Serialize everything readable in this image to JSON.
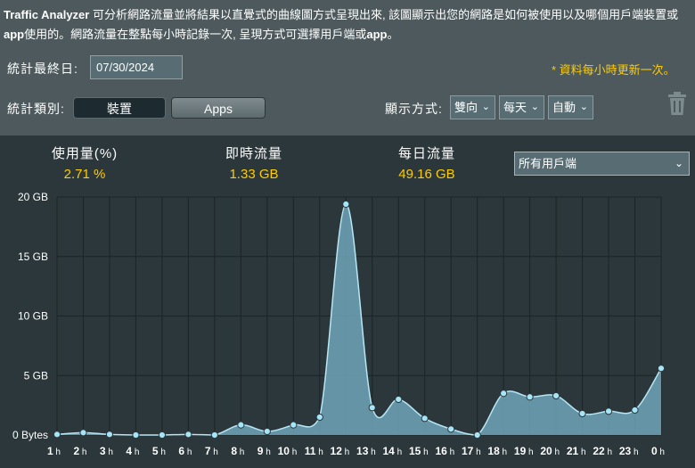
{
  "description": {
    "app_name": "Traffic Analyzer",
    "text_part1": " 可分析網路流量並將結果以直覺式的曲線圖方式呈現出來, 該圖顯示出您的網路是如何被使用以及哪個用戶端裝置或",
    "app_word": "app",
    "text_part2": "使用的。網路流量在整點每小時記錄一次, 呈現方式可選擇用戶端或",
    "app_word2": "app",
    "text_part3": "。"
  },
  "filters": {
    "date_label": "統計最終日:",
    "date_value": "07/30/2024",
    "update_note": "* 資料每小時更新一次。",
    "category_label": "統計類別:",
    "category_options": [
      "裝置",
      "Apps"
    ],
    "category_selected": "裝置",
    "display_label": "顯示方式:",
    "direction": "雙向",
    "period": "每天",
    "unit": "自動"
  },
  "stats": {
    "usage_label": "使用量(%)",
    "usage_value": "2.71 %",
    "realtime_label": "即時流量",
    "realtime_value": "1.33 GB",
    "daily_label": "每日流量",
    "daily_value": "49.16 GB",
    "client_select": "所有用戶端"
  },
  "icons": {
    "trash": "trash-icon",
    "chevron": "chevron-down-icon"
  },
  "colors": {
    "accent": "#ffcc00",
    "area_fill": "#6fa4b8",
    "line": "#b7e6f5",
    "point": "#a6e4f7"
  },
  "chart_data": {
    "type": "area",
    "categories": [
      "1h",
      "2h",
      "3h",
      "4h",
      "5h",
      "6h",
      "7h",
      "8h",
      "9h",
      "10h",
      "11h",
      "12h",
      "13h",
      "14h",
      "15h",
      "16h",
      "17h",
      "18h",
      "19h",
      "20h",
      "21h",
      "22h",
      "23h",
      "0h"
    ],
    "series": [
      {
        "values": [
          0.05,
          0.2,
          0.05,
          0.0,
          0.0,
          0.05,
          0.0,
          0.85,
          0.3,
          0.85,
          1.5,
          19.4,
          2.3,
          3.0,
          1.4,
          0.5,
          0.0,
          3.5,
          3.2,
          3.3,
          1.8,
          2.0,
          2.1,
          5.6
        ]
      }
    ],
    "y_ticks": [
      "0 Bytes",
      "5 GB",
      "10 GB",
      "15 GB",
      "20 GB"
    ],
    "y_tick_values": [
      0,
      5,
      10,
      15,
      20
    ],
    "ylim": [
      0,
      20
    ],
    "grid": true
  }
}
